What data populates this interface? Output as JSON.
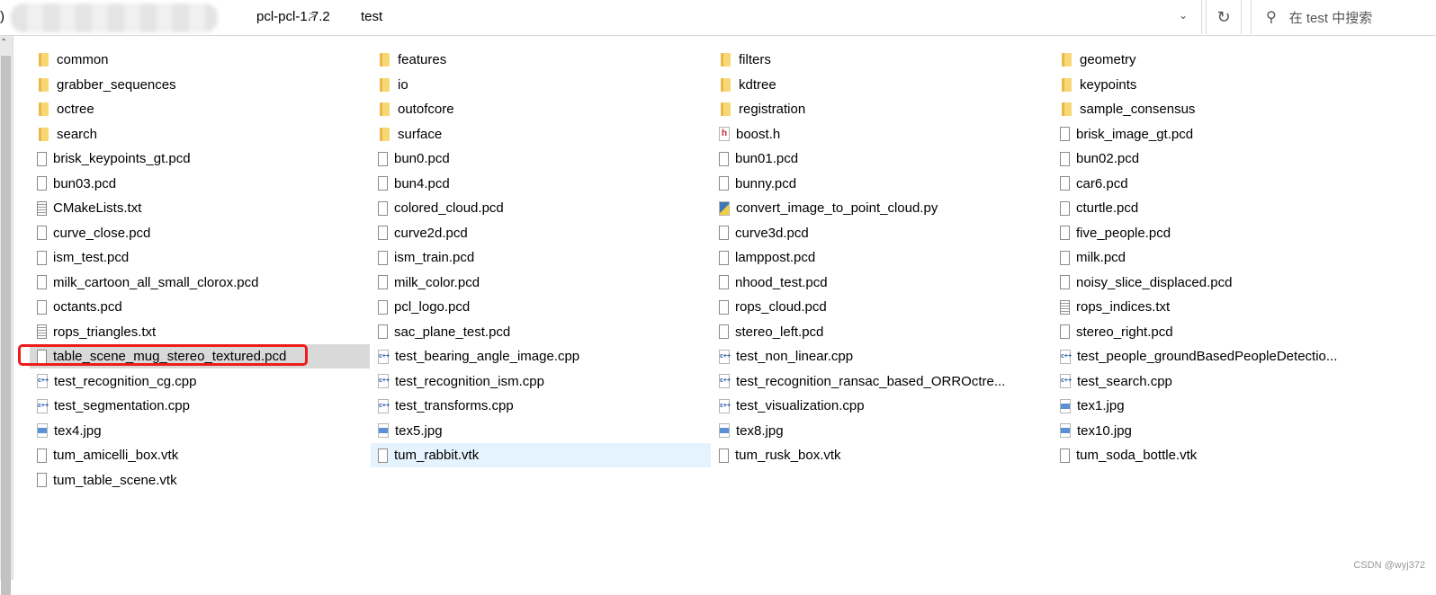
{
  "address_bar": {
    "breadcrumbs": [
      "pcl-pcl-1.7.2",
      "test"
    ],
    "separator": ">"
  },
  "search": {
    "placeholder": "在 test 中搜索"
  },
  "watermark": "CSDN @wyj372",
  "selected_item": "table_scene_mug_stereo_textured.pcd",
  "hovered_item": "tum_rabbit.vtk",
  "highlight_color": "#ef1c1c",
  "files": [
    {
      "name": "common",
      "icon": "folder"
    },
    {
      "name": "features",
      "icon": "folder"
    },
    {
      "name": "filters",
      "icon": "folder"
    },
    {
      "name": "geometry",
      "icon": "folder"
    },
    {
      "name": "grabber_sequences",
      "icon": "folder"
    },
    {
      "name": "io",
      "icon": "folder"
    },
    {
      "name": "kdtree",
      "icon": "folder"
    },
    {
      "name": "keypoints",
      "icon": "folder"
    },
    {
      "name": "octree",
      "icon": "folder"
    },
    {
      "name": "outofcore",
      "icon": "folder"
    },
    {
      "name": "registration",
      "icon": "folder"
    },
    {
      "name": "sample_consensus",
      "icon": "folder"
    },
    {
      "name": "search",
      "icon": "folder"
    },
    {
      "name": "surface",
      "icon": "folder"
    },
    {
      "name": "boost.h",
      "icon": "h"
    },
    {
      "name": "brisk_image_gt.pcd",
      "icon": "file"
    },
    {
      "name": "brisk_keypoints_gt.pcd",
      "icon": "file"
    },
    {
      "name": "bun0.pcd",
      "icon": "file"
    },
    {
      "name": "bun01.pcd",
      "icon": "file"
    },
    {
      "name": "bun02.pcd",
      "icon": "file"
    },
    {
      "name": "bun03.pcd",
      "icon": "file"
    },
    {
      "name": "bun4.pcd",
      "icon": "file"
    },
    {
      "name": "bunny.pcd",
      "icon": "file"
    },
    {
      "name": "car6.pcd",
      "icon": "file"
    },
    {
      "name": "CMakeLists.txt",
      "icon": "txt"
    },
    {
      "name": "colored_cloud.pcd",
      "icon": "file"
    },
    {
      "name": "convert_image_to_point_cloud.py",
      "icon": "py"
    },
    {
      "name": "cturtle.pcd",
      "icon": "file"
    },
    {
      "name": "curve_close.pcd",
      "icon": "file"
    },
    {
      "name": "curve2d.pcd",
      "icon": "file"
    },
    {
      "name": "curve3d.pcd",
      "icon": "file"
    },
    {
      "name": "five_people.pcd",
      "icon": "file"
    },
    {
      "name": "ism_test.pcd",
      "icon": "file"
    },
    {
      "name": "ism_train.pcd",
      "icon": "file"
    },
    {
      "name": "lamppost.pcd",
      "icon": "file"
    },
    {
      "name": "milk.pcd",
      "icon": "file"
    },
    {
      "name": "milk_cartoon_all_small_clorox.pcd",
      "icon": "file"
    },
    {
      "name": "milk_color.pcd",
      "icon": "file"
    },
    {
      "name": "nhood_test.pcd",
      "icon": "file"
    },
    {
      "name": "noisy_slice_displaced.pcd",
      "icon": "file"
    },
    {
      "name": "octants.pcd",
      "icon": "file"
    },
    {
      "name": "pcl_logo.pcd",
      "icon": "file"
    },
    {
      "name": "rops_cloud.pcd",
      "icon": "file"
    },
    {
      "name": "rops_indices.txt",
      "icon": "txt"
    },
    {
      "name": "rops_triangles.txt",
      "icon": "txt"
    },
    {
      "name": "sac_plane_test.pcd",
      "icon": "file"
    },
    {
      "name": "stereo_left.pcd",
      "icon": "file"
    },
    {
      "name": "stereo_right.pcd",
      "icon": "file"
    },
    {
      "name": "table_scene_mug_stereo_textured.pcd",
      "icon": "file"
    },
    {
      "name": "test_bearing_angle_image.cpp",
      "icon": "cpp"
    },
    {
      "name": "test_non_linear.cpp",
      "icon": "cpp"
    },
    {
      "name": "test_people_groundBasedPeopleDetectio...",
      "icon": "cpp"
    },
    {
      "name": "test_recognition_cg.cpp",
      "icon": "cpp"
    },
    {
      "name": "test_recognition_ism.cpp",
      "icon": "cpp"
    },
    {
      "name": "test_recognition_ransac_based_ORROctre...",
      "icon": "cpp"
    },
    {
      "name": "test_search.cpp",
      "icon": "cpp"
    },
    {
      "name": "test_segmentation.cpp",
      "icon": "cpp"
    },
    {
      "name": "test_transforms.cpp",
      "icon": "cpp"
    },
    {
      "name": "test_visualization.cpp",
      "icon": "cpp"
    },
    {
      "name": "tex1.jpg",
      "icon": "jpg"
    },
    {
      "name": "tex4.jpg",
      "icon": "jpg"
    },
    {
      "name": "tex5.jpg",
      "icon": "jpg"
    },
    {
      "name": "tex8.jpg",
      "icon": "jpg"
    },
    {
      "name": "tex10.jpg",
      "icon": "jpg"
    },
    {
      "name": "tum_amicelli_box.vtk",
      "icon": "file"
    },
    {
      "name": "tum_rabbit.vtk",
      "icon": "file"
    },
    {
      "name": "tum_rusk_box.vtk",
      "icon": "file"
    },
    {
      "name": "tum_soda_bottle.vtk",
      "icon": "file"
    },
    {
      "name": "tum_table_scene.vtk",
      "icon": "file"
    }
  ]
}
